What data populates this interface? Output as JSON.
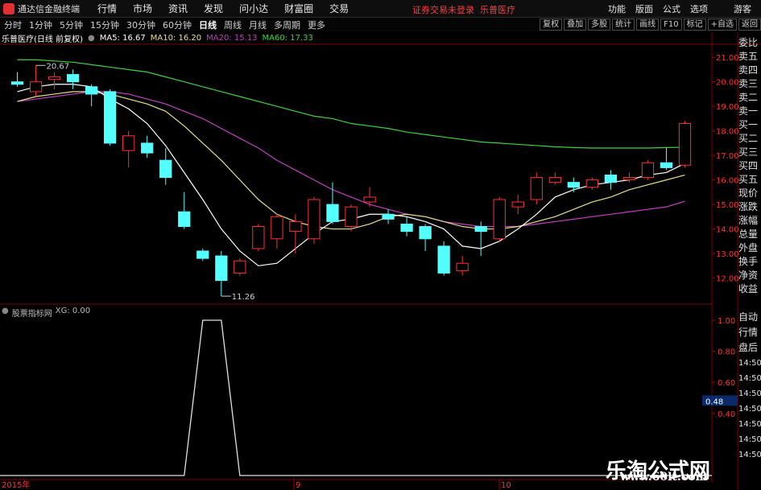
{
  "app": {
    "name": "通达信金融终端",
    "notice": "证券交易未登录",
    "stock": "乐普医疗"
  },
  "menu": [
    "行情",
    "市场",
    "资讯",
    "发现",
    "问小达",
    "财富圈",
    "交易"
  ],
  "right_menu": [
    "功能",
    "版面",
    "公式",
    "选项",
    "游客"
  ],
  "periods": [
    "分时",
    "1分钟",
    "5分钟",
    "15分钟",
    "30分钟",
    "60分钟",
    "日线",
    "周线",
    "月线",
    "多周期",
    "更多"
  ],
  "active_period": "日线",
  "tools": [
    "复权",
    "叠加",
    "多股",
    "统计",
    "画线",
    "F10",
    "标记",
    "+自选",
    "返回"
  ],
  "info": {
    "title": "乐普医疗(日线 前复权)",
    "ma5": "MA5: 16.67",
    "ma10": "MA10: 16.20",
    "ma20": "MA20: 15.13",
    "ma60": "MA60: 17.33"
  },
  "price_axis": [
    "21.00",
    "20.00",
    "19.00",
    "18.00",
    "17.00",
    "16.00",
    "15.00",
    "14.00",
    "13.00",
    "12.00"
  ],
  "annotations": {
    "high": "20.67",
    "low": "11.26"
  },
  "lower": {
    "name": "股票指标网",
    "xg": "XG: 0.00",
    "axis": [
      "1.00",
      "0.80",
      "0.60",
      "0.40"
    ],
    "cursor_value": "0.48"
  },
  "date_labels": [
    "2015年",
    "9",
    "10"
  ],
  "side_panel": [
    "委比",
    "卖五",
    "卖四",
    "卖三",
    "卖二",
    "卖一",
    "买一",
    "买二",
    "买三",
    "买四",
    "买五",
    "现价",
    "涨跌",
    "涨幅",
    "总量",
    "外盘",
    "换手",
    "净资",
    "收益"
  ],
  "side_lower": [
    "自动",
    "行情",
    "盘后",
    "14:50",
    "14:50",
    "14:50",
    "14:50",
    "14:50",
    "14:50",
    "14:50"
  ],
  "watermark": {
    "cn": "乐淘公式网",
    "url": "www.60lt.com"
  },
  "colors": {
    "up": "#ff3030",
    "down": "#54ffff",
    "ma5": "#ffffff",
    "ma10": "#e8e08a",
    "ma20": "#c040c0",
    "ma60": "#40d040"
  },
  "chart_data": {
    "type": "candlestick",
    "candles": [
      {
        "o": 20.0,
        "c": 19.9,
        "h": 20.4,
        "l": 19.8
      },
      {
        "o": 19.6,
        "c": 20.0,
        "h": 20.67,
        "l": 19.4
      },
      {
        "o": 20.1,
        "c": 20.2,
        "h": 20.4,
        "l": 19.7
      },
      {
        "o": 20.3,
        "c": 20.0,
        "h": 20.5,
        "l": 19.7
      },
      {
        "o": 19.8,
        "c": 19.5,
        "h": 19.9,
        "l": 19.0
      },
      {
        "o": 19.6,
        "c": 17.5,
        "h": 19.7,
        "l": 17.4
      },
      {
        "o": 17.2,
        "c": 17.8,
        "h": 18.0,
        "l": 16.5
      },
      {
        "o": 17.5,
        "c": 17.1,
        "h": 17.8,
        "l": 16.9
      },
      {
        "o": 16.8,
        "c": 16.1,
        "h": 17.3,
        "l": 15.8
      },
      {
        "o": 14.7,
        "c": 14.1,
        "h": 15.5,
        "l": 14.0
      },
      {
        "o": 13.1,
        "c": 12.8,
        "h": 13.2,
        "l": 12.7
      },
      {
        "o": 12.9,
        "c": 11.9,
        "h": 13.1,
        "l": 11.26
      },
      {
        "o": 12.2,
        "c": 12.7,
        "h": 12.8,
        "l": 12.1
      },
      {
        "o": 13.2,
        "c": 14.1,
        "h": 14.2,
        "l": 13.1
      },
      {
        "o": 13.6,
        "c": 14.5,
        "h": 14.6,
        "l": 13.2
      },
      {
        "o": 13.9,
        "c": 14.3,
        "h": 14.6,
        "l": 13.0
      },
      {
        "o": 13.6,
        "c": 15.2,
        "h": 15.3,
        "l": 13.4
      },
      {
        "o": 15.0,
        "c": 14.3,
        "h": 15.9,
        "l": 14.2
      },
      {
        "o": 14.1,
        "c": 14.9,
        "h": 15.0,
        "l": 13.9
      },
      {
        "o": 15.1,
        "c": 15.3,
        "h": 15.7,
        "l": 14.9
      },
      {
        "o": 14.6,
        "c": 14.4,
        "h": 14.8,
        "l": 14.2
      },
      {
        "o": 14.2,
        "c": 13.9,
        "h": 14.5,
        "l": 13.7
      },
      {
        "o": 14.1,
        "c": 13.6,
        "h": 14.2,
        "l": 13.1
      },
      {
        "o": 13.3,
        "c": 12.2,
        "h": 13.5,
        "l": 12.1
      },
      {
        "o": 12.3,
        "c": 12.6,
        "h": 12.9,
        "l": 12.1
      },
      {
        "o": 14.1,
        "c": 13.9,
        "h": 14.3,
        "l": 12.9
      },
      {
        "o": 13.6,
        "c": 15.2,
        "h": 15.3,
        "l": 13.5
      },
      {
        "o": 14.9,
        "c": 15.1,
        "h": 15.4,
        "l": 14.6
      },
      {
        "o": 15.2,
        "c": 16.1,
        "h": 16.3,
        "l": 15.0
      },
      {
        "o": 15.9,
        "c": 16.1,
        "h": 16.3,
        "l": 15.8
      },
      {
        "o": 15.9,
        "c": 15.7,
        "h": 16.1,
        "l": 15.5
      },
      {
        "o": 15.7,
        "c": 16.0,
        "h": 16.1,
        "l": 15.6
      },
      {
        "o": 16.2,
        "c": 15.9,
        "h": 16.4,
        "l": 15.6
      },
      {
        "o": 16.0,
        "c": 16.1,
        "h": 16.3,
        "l": 15.9
      },
      {
        "o": 16.1,
        "c": 16.7,
        "h": 16.8,
        "l": 16.0
      },
      {
        "o": 16.7,
        "c": 16.5,
        "h": 17.3,
        "l": 16.4
      },
      {
        "o": 16.6,
        "c": 18.3,
        "h": 18.4,
        "l": 16.5
      }
    ],
    "ma5": [
      19.6,
      19.8,
      19.9,
      19.9,
      19.8,
      19.3,
      18.9,
      18.3,
      17.4,
      16.3,
      15.2,
      14.0,
      13.1,
      12.5,
      12.6,
      13.2,
      13.8,
      14.3,
      14.4,
      14.6,
      14.6,
      14.5,
      14.3,
      14.0,
      13.3,
      13.2,
      13.5,
      14.0,
      14.6,
      15.3,
      15.6,
      15.8,
      15.9,
      16.0,
      16.2,
      16.3,
      16.67
    ],
    "ma10": [
      19.2,
      19.4,
      19.5,
      19.6,
      19.6,
      19.5,
      19.3,
      19.1,
      18.8,
      18.2,
      17.5,
      16.8,
      16.0,
      15.2,
      14.6,
      14.3,
      14.1,
      14.0,
      14.0,
      14.2,
      14.5,
      14.6,
      14.5,
      14.3,
      14.1,
      14.0,
      14.0,
      14.1,
      14.3,
      14.5,
      14.8,
      15.1,
      15.3,
      15.6,
      15.8,
      16.0,
      16.2
    ],
    "ma20": [
      19.2,
      19.3,
      19.4,
      19.5,
      19.6,
      19.6,
      19.5,
      19.3,
      19.1,
      18.8,
      18.5,
      18.1,
      17.7,
      17.3,
      16.8,
      16.4,
      16.0,
      15.6,
      15.3,
      15.0,
      14.8,
      14.6,
      14.5,
      14.3,
      14.2,
      14.1,
      14.1,
      14.1,
      14.2,
      14.3,
      14.4,
      14.5,
      14.6,
      14.7,
      14.8,
      14.9,
      15.13
    ],
    "ma60": [
      20.9,
      20.9,
      20.85,
      20.8,
      20.7,
      20.6,
      20.5,
      20.4,
      20.2,
      20.0,
      19.8,
      19.6,
      19.4,
      19.2,
      19.0,
      18.8,
      18.6,
      18.5,
      18.3,
      18.2,
      18.1,
      17.95,
      17.85,
      17.75,
      17.65,
      17.55,
      17.5,
      17.45,
      17.4,
      17.35,
      17.32,
      17.3,
      17.3,
      17.3,
      17.3,
      17.32,
      17.33
    ],
    "xg": [
      0,
      0,
      0,
      0,
      0,
      0,
      0,
      0,
      0,
      0,
      1,
      1,
      0,
      0,
      0,
      0,
      0,
      0,
      0,
      0,
      0,
      0,
      0,
      0,
      0,
      0,
      0,
      0,
      0,
      0,
      0,
      0,
      0,
      0,
      0,
      0,
      0
    ],
    "ylim": [
      11.0,
      21.5
    ]
  }
}
